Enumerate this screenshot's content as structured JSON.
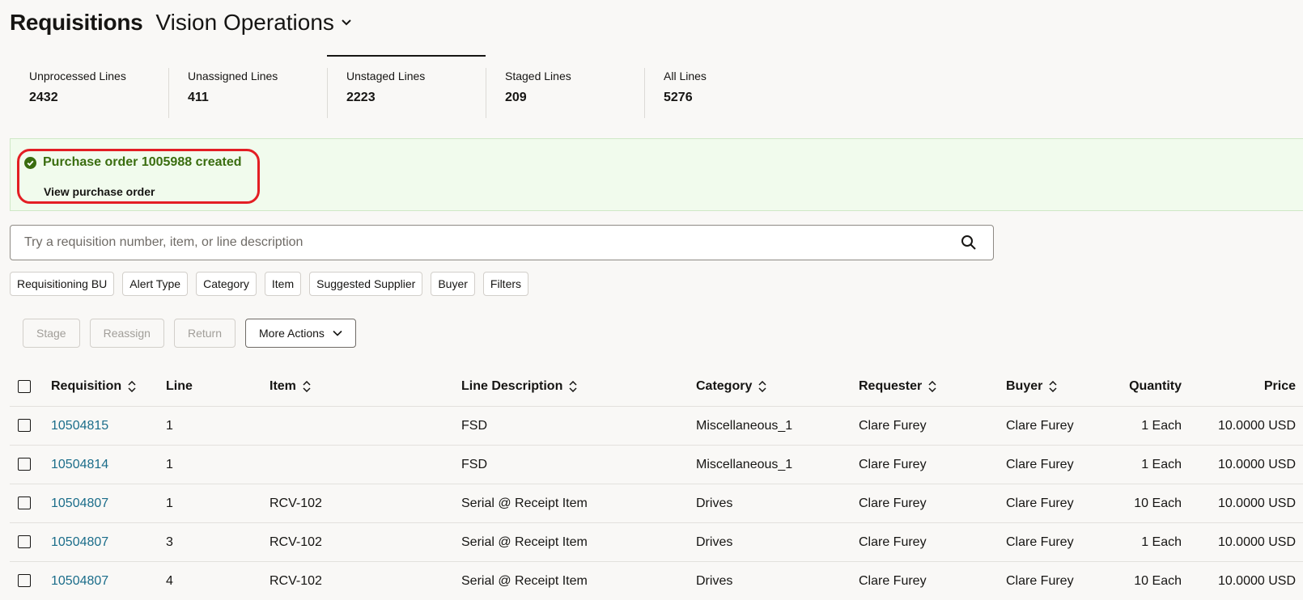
{
  "header": {
    "title": "Requisitions",
    "business_unit": "Vision Operations"
  },
  "tabs": [
    {
      "label": "Unprocessed Lines",
      "count": "2432"
    },
    {
      "label": "Unassigned Lines",
      "count": "411"
    },
    {
      "label": "Unstaged Lines",
      "count": "2223",
      "active": true
    },
    {
      "label": "Staged Lines",
      "count": "209"
    },
    {
      "label": "All Lines",
      "count": "5276"
    }
  ],
  "banner": {
    "message": "Purchase order 1005988 created",
    "link": "View purchase order",
    "status_color": "#3a6d0f"
  },
  "search": {
    "placeholder": "Try a requisition number, item, or line description"
  },
  "filter_chips": [
    "Requisitioning BU",
    "Alert Type",
    "Category",
    "Item",
    "Suggested Supplier",
    "Buyer",
    "Filters"
  ],
  "actions": {
    "stage": "Stage",
    "reassign": "Reassign",
    "return": "Return",
    "more_actions": "More Actions"
  },
  "table": {
    "columns": [
      "Requisition",
      "Line",
      "Item",
      "Line Description",
      "Category",
      "Requester",
      "Buyer",
      "Quantity",
      "Price"
    ],
    "rows": [
      {
        "requisition": "10504815",
        "line": "1",
        "item": "",
        "description": "FSD",
        "category": "Miscellaneous_1",
        "requester": "Clare Furey",
        "buyer": "Clare Furey",
        "quantity": "1 Each",
        "price": "10.0000 USD"
      },
      {
        "requisition": "10504814",
        "line": "1",
        "item": "",
        "description": "FSD",
        "category": "Miscellaneous_1",
        "requester": "Clare Furey",
        "buyer": "Clare Furey",
        "quantity": "1 Each",
        "price": "10.0000 USD"
      },
      {
        "requisition": "10504807",
        "line": "1",
        "item": "RCV-102",
        "description": "Serial @ Receipt Item",
        "category": "Drives",
        "requester": "Clare Furey",
        "buyer": "Clare Furey",
        "quantity": "10 Each",
        "price": "10.0000 USD"
      },
      {
        "requisition": "10504807",
        "line": "3",
        "item": "RCV-102",
        "description": "Serial @ Receipt Item",
        "category": "Drives",
        "requester": "Clare Furey",
        "buyer": "Clare Furey",
        "quantity": "1 Each",
        "price": "10.0000 USD"
      },
      {
        "requisition": "10504807",
        "line": "4",
        "item": "RCV-102",
        "description": "Serial @ Receipt Item",
        "category": "Drives",
        "requester": "Clare Furey",
        "buyer": "Clare Furey",
        "quantity": "10 Each",
        "price": "10.0000 USD"
      }
    ]
  },
  "colors": {
    "link": "#1b6d8a",
    "success_bg": "#f1fbed",
    "highlight": "#e31e24"
  }
}
